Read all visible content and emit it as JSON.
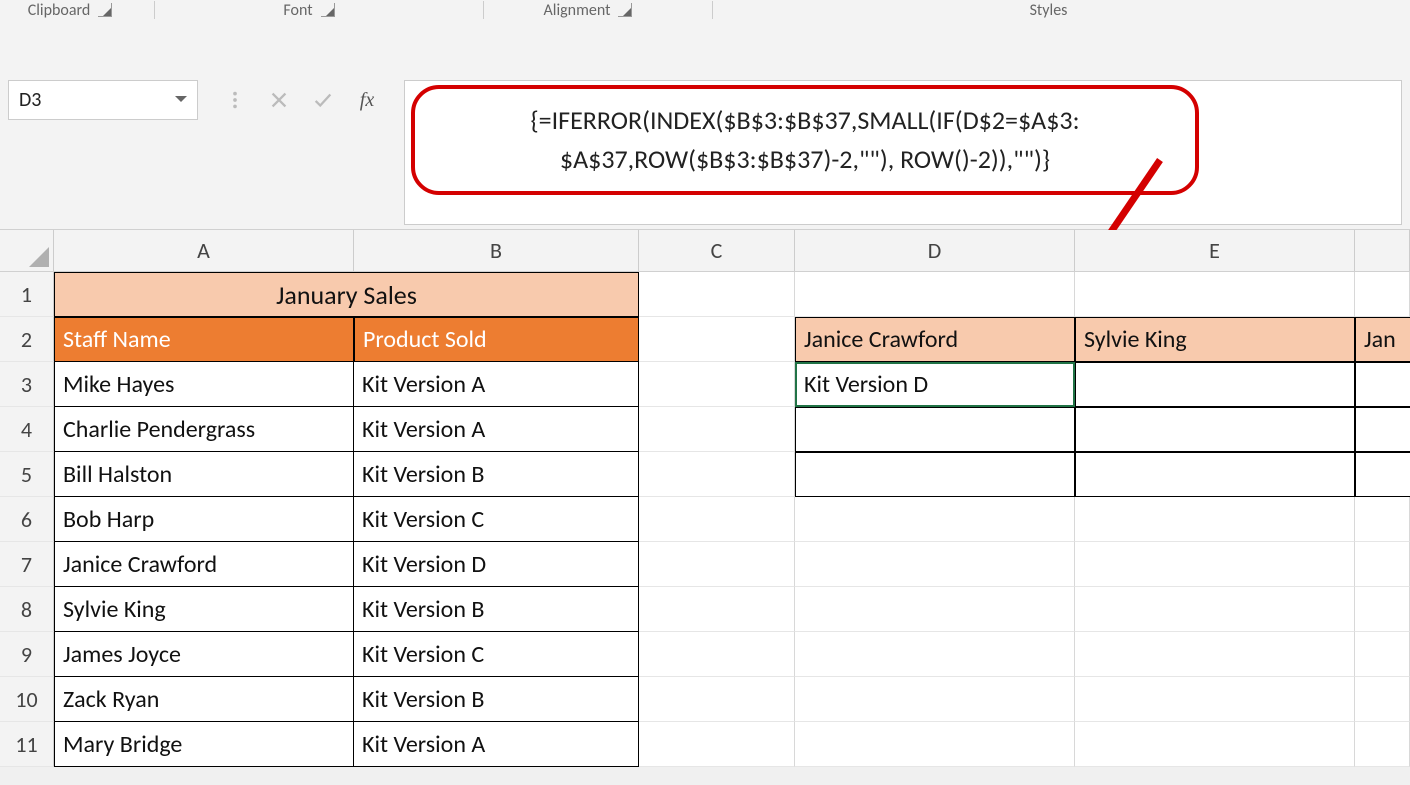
{
  "ribbon": {
    "clipboard": "Clipboard",
    "font": "Font",
    "alignment": "Alignment",
    "styles": "Styles"
  },
  "formula_bar": {
    "name_box": "D3",
    "formula_line1": "{=IFERROR(INDEX($B$3:$B$37,SMALL(IF(D$2=$A$3:",
    "formula_line2": "$A$37,ROW($B$3:$B$37)-2,\"\"), ROW()-2)),\"\")}",
    "fx": "fx"
  },
  "columns": [
    "A",
    "B",
    "C",
    "D",
    "E"
  ],
  "row_nums": [
    "1",
    "2",
    "3",
    "4",
    "5",
    "6",
    "7",
    "8",
    "9",
    "10",
    "11"
  ],
  "table": {
    "title": "January Sales",
    "h1": "Staff Name",
    "h2": "Product Sold",
    "rows": [
      {
        "a": "Mike Hayes",
        "b": "Kit Version A"
      },
      {
        "a": "Charlie Pendergrass",
        "b": "Kit Version A"
      },
      {
        "a": "Bill Halston",
        "b": "Kit Version B"
      },
      {
        "a": "Bob Harp",
        "b": "Kit Version C"
      },
      {
        "a": "Janice Crawford",
        "b": "Kit Version D"
      },
      {
        "a": "Sylvie King",
        "b": "Kit Version B"
      },
      {
        "a": "James Joyce",
        "b": "Kit Version C"
      },
      {
        "a": "Zack Ryan",
        "b": "Kit Version B"
      },
      {
        "a": "Mary Bridge",
        "b": "Kit Version A"
      }
    ]
  },
  "side": {
    "d2": "Janice Crawford",
    "e2": "Sylvie King",
    "f2": "Jan",
    "d3": "Kit Version D"
  }
}
